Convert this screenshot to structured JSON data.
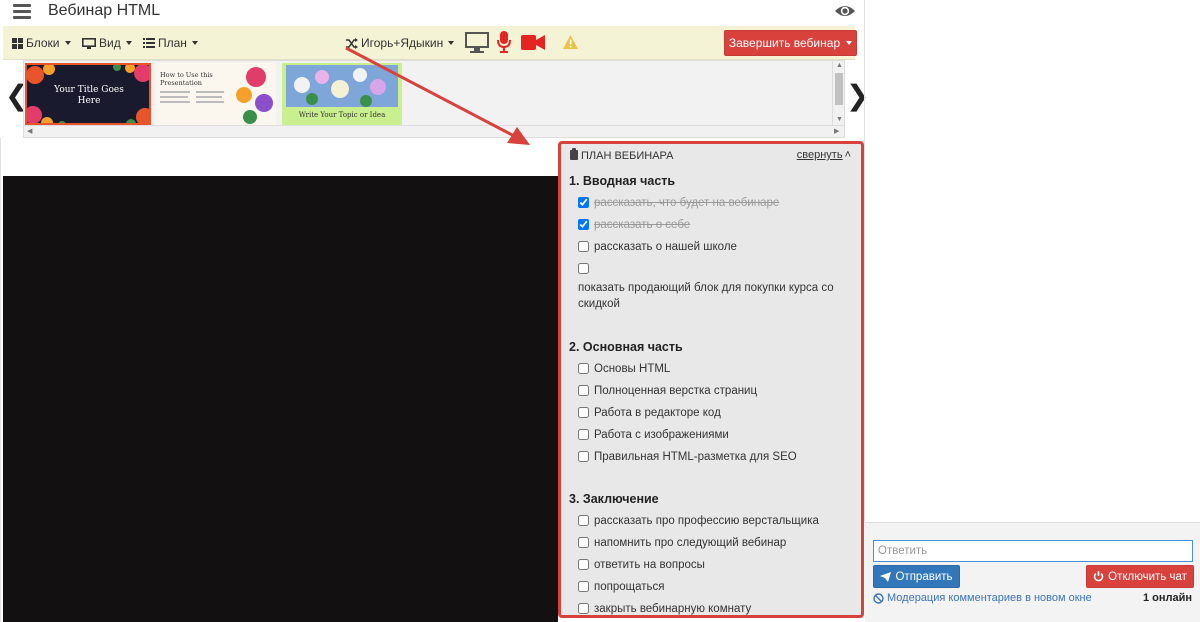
{
  "header": {
    "title": "Вебинар HTML"
  },
  "toolbar": {
    "blocks_label": "Блоки",
    "view_label": "Вид",
    "plan_label": "План",
    "presenter_label": "Игорь+Ядыкин",
    "end_webinar_label": "Завершить вебинар"
  },
  "slides": [
    {
      "text": "Your Title Goes Here"
    },
    {
      "text": "How to Use this Presentation"
    },
    {
      "text": "Write Your Topic or Idea"
    }
  ],
  "plan": {
    "title": "ПЛАН ВЕБИНАРА",
    "collapse_label": "свернуть",
    "sections": [
      {
        "title": "1. Вводная часть",
        "items": [
          {
            "label": "рассказать, что будет на вебинаре",
            "checked": true
          },
          {
            "label": "рассказать о себе",
            "checked": true
          },
          {
            "label": "рассказать о нашей школе",
            "checked": false
          },
          {
            "label": "показать продающий блок для покупки курса со скидкой",
            "checked": false
          }
        ]
      },
      {
        "title": "2. Основная часть",
        "items": [
          {
            "label": "Основы HTML",
            "checked": false
          },
          {
            "label": "Полноценная верстка страниц",
            "checked": false
          },
          {
            "label": "Работа в редакторе код",
            "checked": false
          },
          {
            "label": "Работа с изображениями",
            "checked": false
          },
          {
            "label": "Правильная HTML-разметка для SEO",
            "checked": false
          }
        ]
      },
      {
        "title": "3. Заключение",
        "items": [
          {
            "label": "рассказать про профессию верстальщика",
            "checked": false
          },
          {
            "label": "напомнить про следующий вебинар",
            "checked": false
          },
          {
            "label": "ответить на вопросы",
            "checked": false
          },
          {
            "label": "попрощаться",
            "checked": false
          },
          {
            "label": "закрыть вебинарную комнату",
            "checked": false
          }
        ]
      }
    ]
  },
  "chat": {
    "reply_placeholder": "Ответить",
    "send_label": "Отправить",
    "disable_chat_label": "Отключить чат",
    "moderation_label": "Модерация комментариев в новом окне",
    "online_label": "1 онлайн"
  },
  "colors": {
    "accent_red": "#d9413d",
    "send_blue": "#3377bb",
    "toolbar_bg": "#f5f3d6",
    "annotation_red": "#d9423c"
  },
  "icons": {
    "blocks": "grid-icon",
    "view": "monitor-icon",
    "plan": "list-icon",
    "presenter": "shuffle-icon",
    "screen": "screen-share-icon",
    "mic": "microphone-icon",
    "camera": "video-camera-icon",
    "warning": "warning-icon",
    "eye": "eye-icon"
  }
}
